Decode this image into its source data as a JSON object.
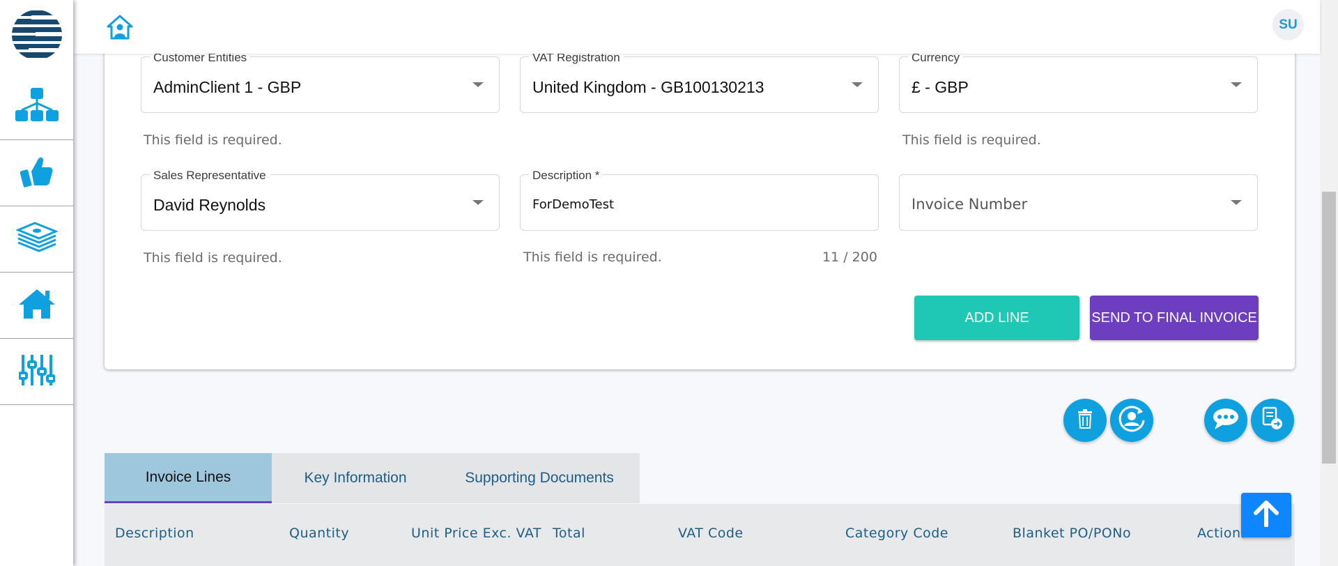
{
  "header": {
    "avatar_initials": "SU"
  },
  "form": {
    "customer_entities": {
      "label": "Customer Entities",
      "value": "AdminClient 1 - GBP",
      "hint": "This field is required."
    },
    "vat_registration": {
      "label": "VAT Registration",
      "value": "United Kingdom - GB100130213"
    },
    "currency": {
      "label": "Currency",
      "value": "£ - GBP",
      "hint": "This field is required."
    },
    "sales_representative": {
      "label": "Sales Representative",
      "value": "David Reynolds",
      "hint": "This field is required."
    },
    "description": {
      "label": "Description *",
      "value": "ForDemoTest",
      "hint": "This field is required.",
      "counter": "11 / 200"
    },
    "invoice_number": {
      "placeholder": "Invoice Number"
    },
    "add_line_label": "ADD LINE",
    "send_final_label": "SEND TO FINAL INVOICE"
  },
  "tabs": [
    {
      "label": "Invoice Lines",
      "active": true
    },
    {
      "label": "Key Information",
      "active": false
    },
    {
      "label": "Supporting Documents",
      "active": false
    }
  ],
  "table": {
    "columns": [
      "Description",
      "Quantity",
      "Unit Price Exc. VAT",
      "Total",
      "VAT Code",
      "Category Code",
      "Blanket PO/PONo",
      "Actions"
    ]
  },
  "colors": {
    "accent_blue": "#0ea0df",
    "add_line": "#1fc8b4",
    "send_final": "#6d3fc0",
    "scroll_top": "#0e86ff"
  },
  "icons": {
    "sidebar": [
      "hierarchy-icon",
      "thumbs-up-icon",
      "money-stack-icon",
      "house-icon",
      "sliders-icon"
    ],
    "actions": [
      "trash-icon",
      "user-refresh-icon",
      "chat-icon",
      "document-export-icon"
    ]
  }
}
